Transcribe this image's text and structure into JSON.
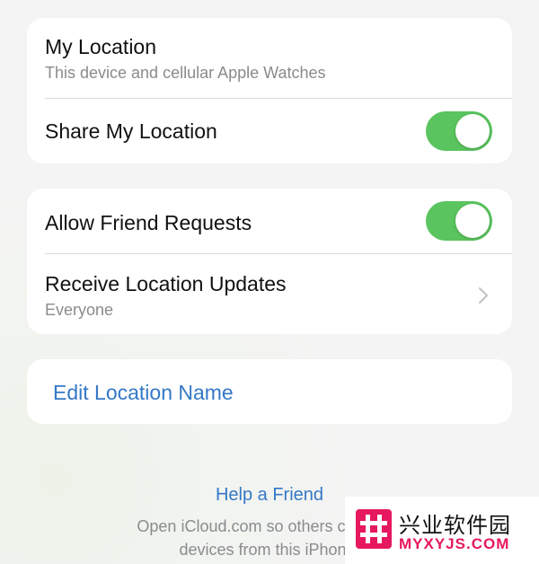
{
  "my_location": {
    "title": "My Location",
    "subtitle": "This device and cellular Apple Watches"
  },
  "share_location": {
    "label": "Share My Location",
    "enabled": true
  },
  "friend_requests": {
    "label": "Allow Friend Requests",
    "enabled": true
  },
  "location_updates": {
    "label": "Receive Location Updates",
    "value": "Everyone"
  },
  "edit_location_name": {
    "label": "Edit Location Name"
  },
  "footer": {
    "link": "Help a Friend",
    "line1": "Open iCloud.com so others can login",
    "line2": "devices from this iPhone."
  },
  "watermark": {
    "cn": "兴业软件园",
    "en": "MYXYJS.COM"
  },
  "colors": {
    "toggle_on": "#5ac45e",
    "link": "#3478c6",
    "watermark_accent": "#e6185f"
  },
  "icons": {
    "chevron": "chevron-right-icon",
    "logo": "hash-logo-icon"
  }
}
